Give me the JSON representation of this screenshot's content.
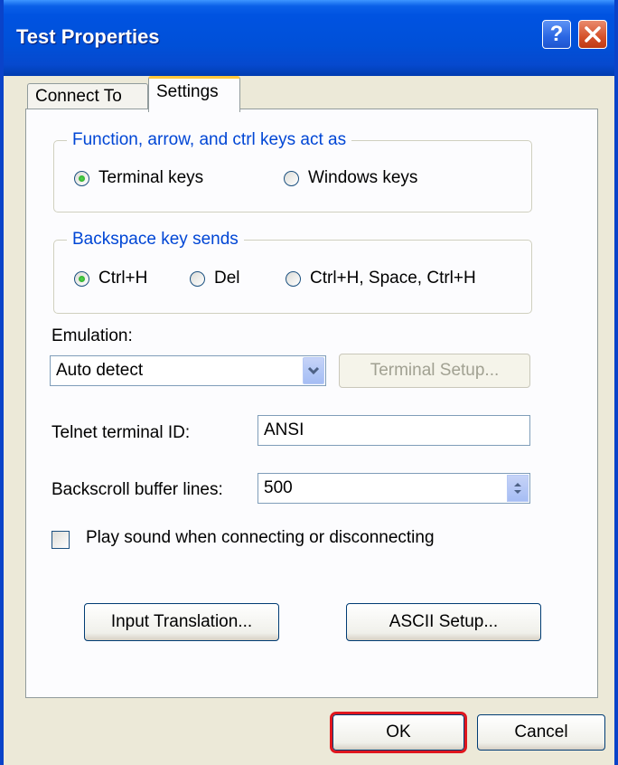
{
  "window": {
    "title": "Test Properties"
  },
  "tabs": [
    {
      "label": "Connect To"
    },
    {
      "label": "Settings"
    }
  ],
  "function_keys": {
    "title": "Function, arrow, and ctrl keys act as",
    "options": [
      "Terminal keys",
      "Windows keys"
    ],
    "selected": "Terminal keys"
  },
  "backspace": {
    "title": "Backspace key sends",
    "options": [
      "Ctrl+H",
      "Del",
      "Ctrl+H, Space, Ctrl+H"
    ],
    "selected": "Ctrl+H"
  },
  "emulation": {
    "label": "Emulation:",
    "value": "Auto detect",
    "terminal_setup_label": "Terminal Setup..."
  },
  "telnet": {
    "label": "Telnet terminal ID:",
    "value": "ANSI"
  },
  "backscroll": {
    "label": "Backscroll buffer lines:",
    "value": "500"
  },
  "sound": {
    "label": "Play sound when connecting or disconnecting",
    "checked": false
  },
  "buttons": {
    "input_translation": "Input Translation...",
    "ascii_setup": "ASCII Setup...",
    "ok": "OK",
    "cancel": "Cancel"
  },
  "colors": {
    "title_bar": "#0050D8",
    "group_title": "#0046D5",
    "ok_highlight": "#E0161E"
  }
}
